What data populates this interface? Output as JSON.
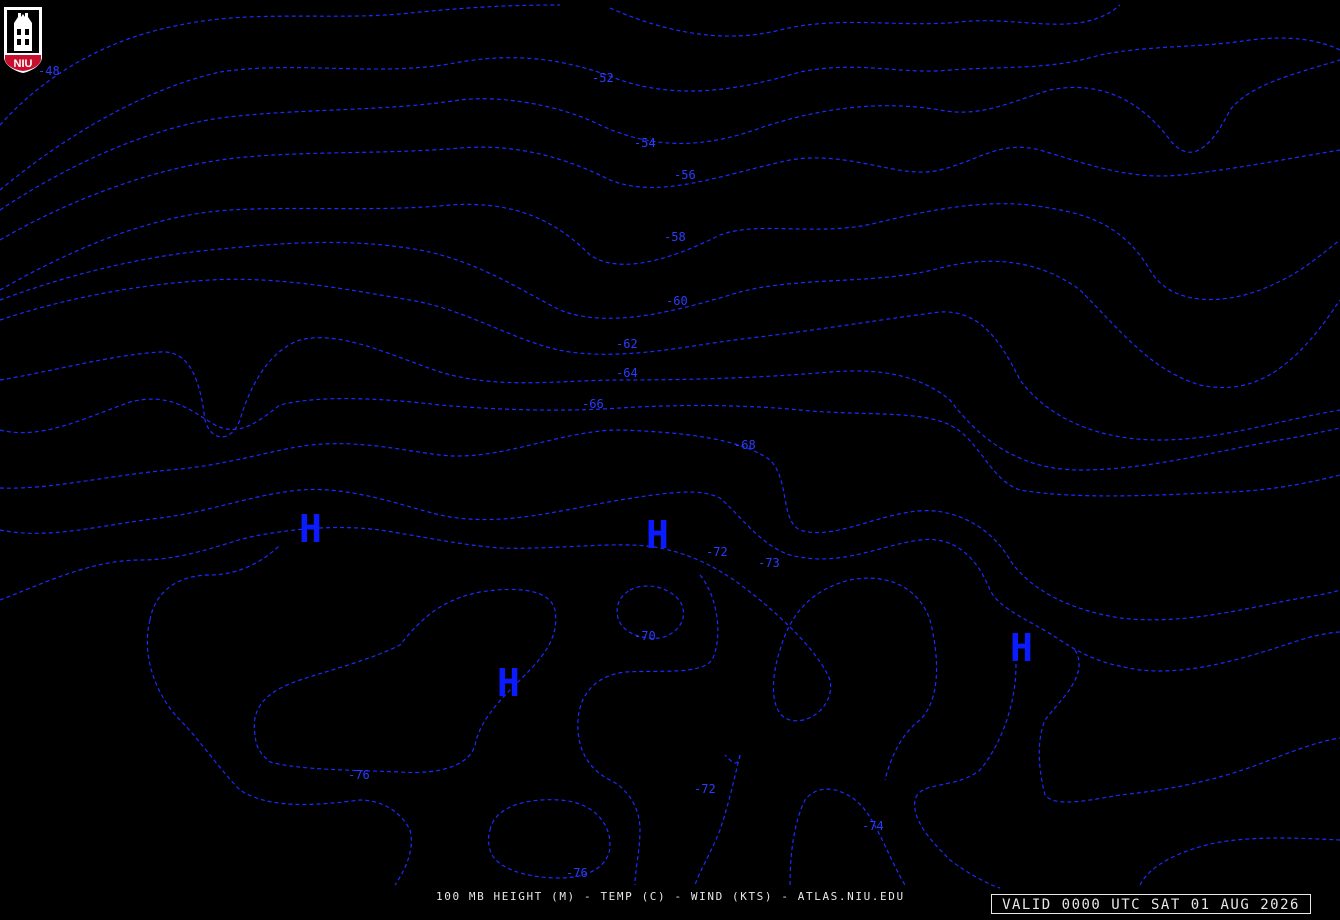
{
  "logo": {
    "text": "NIU",
    "icon": "niu-tower-logo-icon",
    "bg": "#c8102e",
    "fg": "#ffffff"
  },
  "colors": {
    "contour": "#1a2cff",
    "high_marker": "#0a1cff",
    "background": "#000000",
    "footer_text": "#e8e8e8"
  },
  "footer": {
    "caption": "100 MB HEIGHT (M) - TEMP (C) - WIND (KTS) - ATLAS.NIU.EDU"
  },
  "valid_time": {
    "text": "VALID 0000 UTC SAT 01 AUG 2026"
  },
  "map": {
    "contour_labels": [
      "-48",
      "-52",
      "-54",
      "-56",
      "-58",
      "-60",
      "-62",
      "-64",
      "-66",
      "-68",
      "-72",
      "-73",
      "-70",
      "-76",
      "-72",
      "-74",
      "-76"
    ],
    "high_pressure_centers": [
      {
        "label": "H"
      },
      {
        "label": "H"
      },
      {
        "label": "H"
      },
      {
        "label": "H"
      }
    ]
  }
}
